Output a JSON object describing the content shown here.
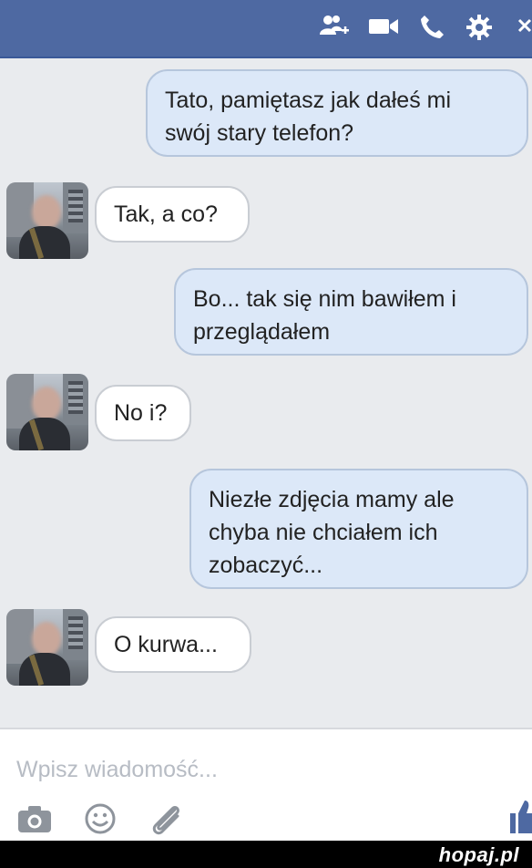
{
  "header": {
    "icons": [
      "add-people-icon",
      "video-call-icon",
      "phone-icon",
      "settings-gear-icon",
      "close-icon"
    ],
    "colors": {
      "bar": "#4e69a2",
      "icon": "#ffffff"
    }
  },
  "messages": [
    {
      "side": "out",
      "text_lines": [
        "Tato, pamiętasz jak dałeś mi",
        "swój stary telefon?"
      ]
    },
    {
      "side": "in",
      "text_lines": [
        "Tak, a co?"
      ]
    },
    {
      "side": "out",
      "text_lines": [
        "Bo... tak się nim bawiłem i",
        "przeglądałem"
      ]
    },
    {
      "side": "in",
      "text_lines": [
        "No i?"
      ]
    },
    {
      "side": "out",
      "text_lines": [
        "Niezłe zdjęcia mamy ale",
        "chyba nie chciałem ich",
        "zobaczyć..."
      ]
    },
    {
      "side": "in",
      "text_lines": [
        "O kurwa..."
      ]
    }
  ],
  "composer": {
    "placeholder": "Wpisz wiadomość...",
    "icons": [
      "camera-icon",
      "emoji-icon",
      "attachment-icon",
      "like-thumb-icon"
    ]
  },
  "watermark": {
    "brand": "hopaj.pl"
  }
}
